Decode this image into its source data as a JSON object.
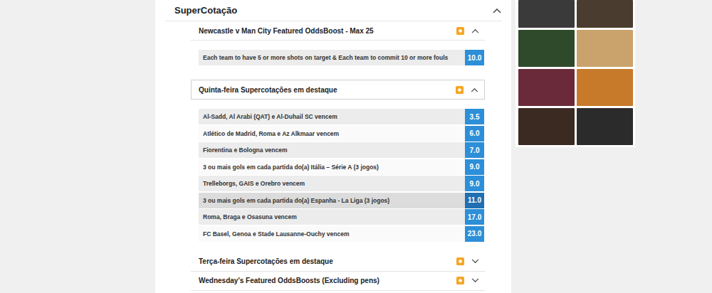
{
  "panel": {
    "title": "SuperCotação",
    "expanded": true
  },
  "sections": [
    {
      "title": "Newcastle v Man City Featured OddsBoost - Max 25",
      "expanded": true,
      "focused": false,
      "rows": [
        {
          "label": "Each team to have 5 or more shots on target & Each team to commit 10 or more fouls",
          "odds": "10.0",
          "highlighted": false
        }
      ]
    },
    {
      "title": "Quinta-feira Supercotações em destaque",
      "expanded": true,
      "focused": true,
      "rows": [
        {
          "label": "Al-Sadd, Al Arabi (QAT) e Al-Duhail SC vencem",
          "odds": "3.5",
          "highlighted": false
        },
        {
          "label": "Atlético de Madrid, Roma e Az Alkmaar vencem",
          "odds": "6.0",
          "highlighted": false
        },
        {
          "label": "Fiorentina e Bologna vencem",
          "odds": "7.0",
          "highlighted": false
        },
        {
          "label": "3 ou mais gols em cada partida do(a) Itália – Série A (3 jogos)",
          "odds": "9.0",
          "highlighted": false
        },
        {
          "label": "Trelleborgs, GAIS e Orebro vencem",
          "odds": "9.0",
          "highlighted": false
        },
        {
          "label": "3 ou mais gols em cada partida do(a) Espanha - La Liga (3 jogos)",
          "odds": "11.0",
          "highlighted": true
        },
        {
          "label": "Roma, Braga e Osasuna vencem",
          "odds": "17.0",
          "highlighted": false
        },
        {
          "label": "FC Basel, Genoa e Stade Lausanne-Ouchy vencem",
          "odds": "23.0",
          "highlighted": false
        }
      ]
    },
    {
      "title": "Terça-feira Supercotações em destaque",
      "expanded": false,
      "focused": false,
      "rows": []
    },
    {
      "title": "Wednesday's Featured OddsBoosts (Excluding pens)",
      "expanded": false,
      "focused": false,
      "rows": []
    }
  ],
  "casino_tiles": [
    {
      "color": "#3a3a3a"
    },
    {
      "color": "#4a3c2e"
    },
    {
      "color": "#2f4a2a"
    },
    {
      "color": "#c9a26c"
    },
    {
      "color": "#6b2a3a"
    },
    {
      "color": "#c77a2a"
    },
    {
      "color": "#3b2a22"
    },
    {
      "color": "#2b2b2b"
    }
  ]
}
